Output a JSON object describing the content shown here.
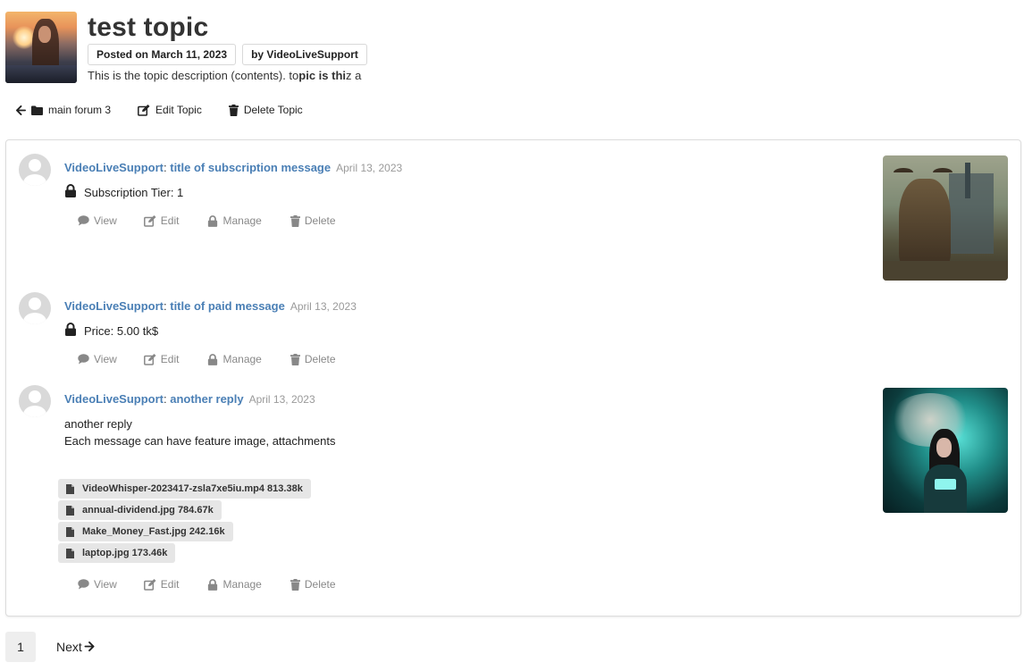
{
  "topic": {
    "title": "test topic",
    "posted": "Posted on March 11, 2023",
    "by": "by VideoLiveSupport",
    "description_prefix": "This is the topic description (contents). to",
    "description_bold1": "pic is thi",
    "description_suffix": "z a"
  },
  "topic_actions": {
    "back_label": "main forum 3",
    "edit_label": "Edit Topic",
    "delete_label": "Delete Topic"
  },
  "message_actions": {
    "view": "View",
    "edit": "Edit",
    "manage": "Manage",
    "delete": "Delete"
  },
  "messages": [
    {
      "author": "VideoLiveSupport",
      "title": "title of subscription message",
      "date": "April 13, 2023",
      "locked_text": "Subscription Tier: 1"
    },
    {
      "author": "VideoLiveSupport",
      "title": "title of paid message",
      "date": "April 13, 2023",
      "locked_text": "Price: 5.00 tk$"
    },
    {
      "author": "VideoLiveSupport",
      "title": "another reply",
      "date": "April 13, 2023",
      "body_line1": "another reply",
      "body_line2": "Each message can have feature image, attachments",
      "attachments": [
        "VideoWhisper-2023417-zsla7xe5iu.mp4 813.38k",
        "annual-dividend.jpg 784.67k",
        "Make_Money_Fast.jpg 242.16k",
        "laptop.jpg 173.46k"
      ]
    }
  ],
  "pagination": {
    "current": "1",
    "next": "Next"
  },
  "colors": {
    "link": "#4a7fb5",
    "muted": "#888888",
    "date": "#9a9a9a"
  }
}
